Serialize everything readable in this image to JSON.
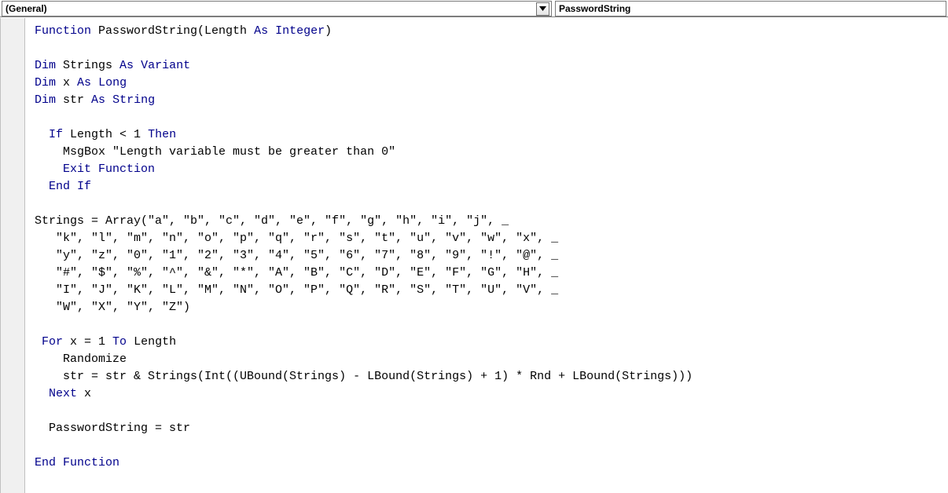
{
  "dropdowns": {
    "object": "(General)",
    "procedure": "PasswordString"
  },
  "code": {
    "lines": [
      [
        [
          "kw",
          "Function"
        ],
        [
          "t",
          " PasswordString(Length "
        ],
        [
          "kw",
          "As"
        ],
        [
          "t",
          " "
        ],
        [
          "kw",
          "Integer"
        ],
        [
          "t",
          ")"
        ]
      ],
      [],
      [
        [
          "kw",
          "Dim"
        ],
        [
          "t",
          " Strings "
        ],
        [
          "kw",
          "As"
        ],
        [
          "t",
          " "
        ],
        [
          "kw",
          "Variant"
        ]
      ],
      [
        [
          "kw",
          "Dim"
        ],
        [
          "t",
          " x "
        ],
        [
          "kw",
          "As"
        ],
        [
          "t",
          " "
        ],
        [
          "kw",
          "Long"
        ]
      ],
      [
        [
          "kw",
          "Dim"
        ],
        [
          "t",
          " str "
        ],
        [
          "kw",
          "As"
        ],
        [
          "t",
          " "
        ],
        [
          "kw",
          "String"
        ]
      ],
      [],
      [
        [
          "t",
          "  "
        ],
        [
          "kw",
          "If"
        ],
        [
          "t",
          " Length < 1 "
        ],
        [
          "kw",
          "Then"
        ]
      ],
      [
        [
          "t",
          "    MsgBox \"Length variable must be greater than 0\""
        ]
      ],
      [
        [
          "t",
          "    "
        ],
        [
          "kw",
          "Exit Function"
        ]
      ],
      [
        [
          "t",
          "  "
        ],
        [
          "kw",
          "End"
        ],
        [
          "t",
          " "
        ],
        [
          "kw",
          "If"
        ]
      ],
      [],
      [
        [
          "t",
          "Strings = Array(\"a\", \"b\", \"c\", \"d\", \"e\", \"f\", \"g\", \"h\", \"i\", \"j\", _"
        ]
      ],
      [
        [
          "t",
          "   \"k\", \"l\", \"m\", \"n\", \"o\", \"p\", \"q\", \"r\", \"s\", \"t\", \"u\", \"v\", \"w\", \"x\", _"
        ]
      ],
      [
        [
          "t",
          "   \"y\", \"z\", \"0\", \"1\", \"2\", \"3\", \"4\", \"5\", \"6\", \"7\", \"8\", \"9\", \"!\", \"@\", _"
        ]
      ],
      [
        [
          "t",
          "   \"#\", \"$\", \"%\", \"^\", \"&\", \"*\", \"A\", \"B\", \"C\", \"D\", \"E\", \"F\", \"G\", \"H\", _"
        ]
      ],
      [
        [
          "t",
          "   \"I\", \"J\", \"K\", \"L\", \"M\", \"N\", \"O\", \"P\", \"Q\", \"R\", \"S\", \"T\", \"U\", \"V\", _"
        ]
      ],
      [
        [
          "t",
          "   \"W\", \"X\", \"Y\", \"Z\")"
        ]
      ],
      [],
      [
        [
          "t",
          " "
        ],
        [
          "kw",
          "For"
        ],
        [
          "t",
          " x = 1 "
        ],
        [
          "kw",
          "To"
        ],
        [
          "t",
          " Length"
        ]
      ],
      [
        [
          "t",
          "    Randomize"
        ]
      ],
      [
        [
          "t",
          "    str = str & Strings(Int((UBound(Strings) - LBound(Strings) + 1) * Rnd + LBound(Strings)))"
        ]
      ],
      [
        [
          "t",
          "  "
        ],
        [
          "kw",
          "Next"
        ],
        [
          "t",
          " x"
        ]
      ],
      [],
      [
        [
          "t",
          "  PasswordString = str"
        ]
      ],
      [],
      [
        [
          "kw",
          "End Function"
        ]
      ]
    ]
  }
}
